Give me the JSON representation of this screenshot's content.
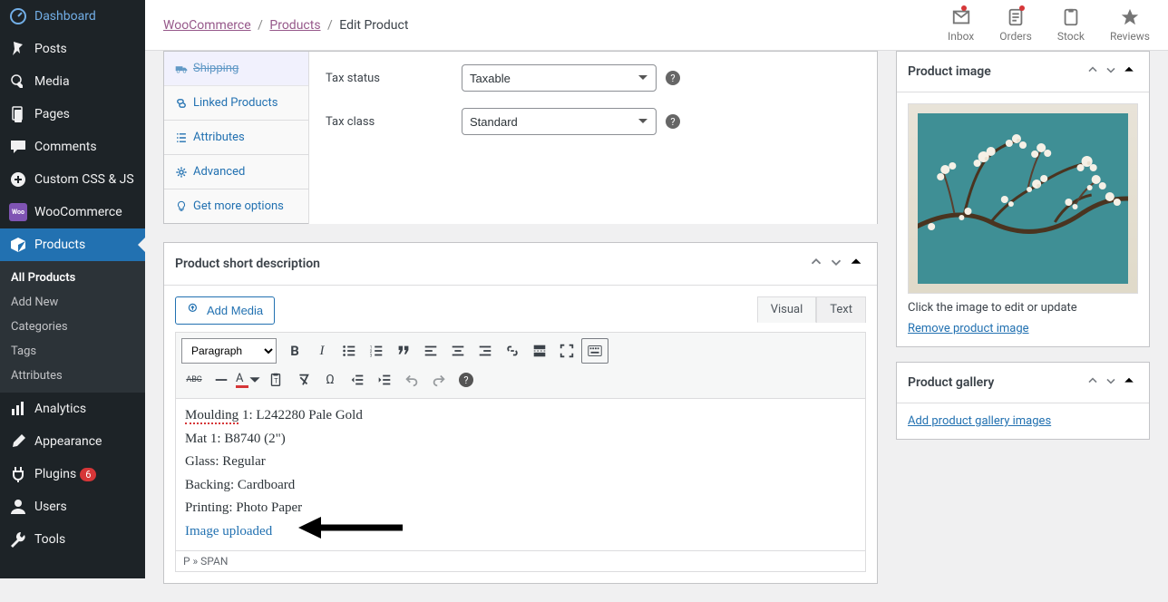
{
  "sidebar": {
    "items": [
      {
        "label": "Dashboard",
        "icon": "dashboard"
      },
      {
        "label": "Posts",
        "icon": "pin"
      },
      {
        "label": "Media",
        "icon": "media"
      },
      {
        "label": "Pages",
        "icon": "pages"
      },
      {
        "label": "Comments",
        "icon": "comments"
      },
      {
        "label": "Custom CSS & JS",
        "icon": "plus"
      },
      {
        "label": "WooCommerce",
        "icon": "woo"
      },
      {
        "label": "Products",
        "icon": "products",
        "active": true
      },
      {
        "label": "Analytics",
        "icon": "analytics"
      },
      {
        "label": "Appearance",
        "icon": "brush"
      },
      {
        "label": "Plugins",
        "icon": "plug",
        "badge": "6"
      },
      {
        "label": "Users",
        "icon": "users"
      },
      {
        "label": "Tools",
        "icon": "tools"
      }
    ],
    "submenu": [
      {
        "label": "All Products",
        "active": true
      },
      {
        "label": "Add New"
      },
      {
        "label": "Categories"
      },
      {
        "label": "Tags"
      },
      {
        "label": "Attributes"
      }
    ]
  },
  "breadcrumb": {
    "parts": [
      "WooCommerce",
      "Products",
      "Edit Product"
    ]
  },
  "topbar_icons": [
    {
      "label": "Inbox",
      "dot": true
    },
    {
      "label": "Orders",
      "dot": true
    },
    {
      "label": "Stock"
    },
    {
      "label": "Reviews"
    }
  ],
  "product_data": {
    "tabs": [
      {
        "label": "Shipping",
        "icon": "truck",
        "cutoff": true
      },
      {
        "label": "Linked Products",
        "icon": "link"
      },
      {
        "label": "Attributes",
        "icon": "list"
      },
      {
        "label": "Advanced",
        "icon": "gear"
      },
      {
        "label": "Get more options",
        "icon": "bulb"
      }
    ],
    "fields": {
      "tax_status_label": "Tax status",
      "tax_status_value": "Taxable",
      "tax_class_label": "Tax class",
      "tax_class_value": "Standard"
    }
  },
  "short_desc": {
    "title": "Product short description",
    "add_media": "Add Media",
    "tab_visual": "Visual",
    "tab_text": "Text",
    "format_select": "Paragraph",
    "content": {
      "line1_pre": "Moulding",
      "line1_post": " 1: L242280 Pale Gold",
      "line2": "Mat 1: B8740 (2\")",
      "line3": "Glass: Regular",
      "line4": "Backing: Cardboard",
      "line5": "Printing: Photo Paper",
      "line6": "Image uploaded"
    },
    "status": "P » SPAN",
    "abc": "ABC"
  },
  "right": {
    "product_image_title": "Product image",
    "product_image_hint": "Click the image to edit or update",
    "product_image_remove": "Remove product image",
    "product_gallery_title": "Product gallery",
    "product_gallery_link": "Add product gallery images"
  }
}
